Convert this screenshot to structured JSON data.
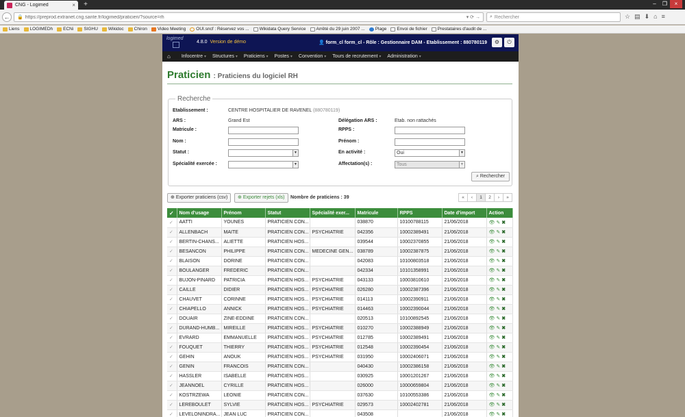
{
  "browser": {
    "tab_title": "CNG - Logimed",
    "url": "https://preprod.extranet.cng.sante.fr/logimed/praticien/?source=rh",
    "search_placeholder": "Rechercher",
    "bookmarks": [
      "Liens",
      "LOGIMEDh",
      "ECNi",
      "SIGHU",
      "Wikidoc",
      "Chiron",
      "Video Meeting",
      "OUI.sncf : Réservez vos ...",
      "Wikidata Query Service",
      "Arrêté du 29 juin 2007 ...",
      "Plage",
      "Envoi de fichier",
      "Prestataires d'audit de ..."
    ]
  },
  "header": {
    "logo": "logimed",
    "version": "4.8.0",
    "version_note": "Version de démo",
    "user": "form_cl form_cl - Rôle : Gestionnaire DAM - Etablissement : 880780119"
  },
  "nav": [
    "Infocentre",
    "Structures",
    "Praticiens",
    "Postes",
    "Convention",
    "Tours de recrutement",
    "Administration"
  ],
  "page": {
    "title": "Praticien",
    "subtitle": ": Praticiens du logiciel RH"
  },
  "search": {
    "legend": "Recherche",
    "etablissement_label": "Etablissement :",
    "etablissement_value": "CENTRE HOSPITALIER DE RAVENEL",
    "etablissement_code": "(880780119)",
    "ars_label": "ARS :",
    "ars_value": "Grand Est",
    "delegation_label": "Délégation ARS :",
    "delegation_value": "Etab. non rattachés",
    "matricule_label": "Matricule :",
    "rpps_label": "RPPS :",
    "nom_label": "Nom :",
    "prenom_label": "Prénom :",
    "statut_label": "Statut :",
    "activite_label": "En activité :",
    "activite_value": "Oui",
    "specialite_label": "Spécialité exercée :",
    "affectation_label": "Affectation(s) :",
    "affectation_value": "Tous",
    "button": "Rechercher"
  },
  "toolbar": {
    "export_praticiens": "Exporter praticiens (csv)",
    "export_rejets": "Exporter rejets (xls)",
    "count": "Nombre de praticiens : 39"
  },
  "pager": [
    "«",
    "‹",
    "1",
    "2",
    "›",
    "»"
  ],
  "table": {
    "columns": [
      "Nom d'usage",
      "Prénom",
      "Statut",
      "Spécialité exer...",
      "Matricule",
      "RPPS",
      "Date d'import",
      "Action"
    ],
    "rows": [
      [
        "AATTI",
        "YOUNES",
        "PRATICIEN CON...",
        "",
        "038870",
        "10100788115",
        "21/06/2018"
      ],
      [
        "ALLENBACH",
        "MAITE",
        "PRATICIEN CON...",
        "PSYCHIATRIE",
        "042356",
        "10002389491",
        "21/06/2018"
      ],
      [
        "BERTIN-CHANS...",
        "ALIETTE",
        "PRATICIEN HOS...",
        "",
        "039544",
        "10002370855",
        "21/06/2018"
      ],
      [
        "BESANCON",
        "PHILIPPE",
        "PRATICIEN CON...",
        "MEDECINE GEN...",
        "038789",
        "10002387875",
        "21/06/2018"
      ],
      [
        "BLAISON",
        "DORINE",
        "PRATICIEN CON...",
        "",
        "042083",
        "10100803518",
        "21/06/2018"
      ],
      [
        "BOULANGER",
        "FREDERIC",
        "PRATICIEN CON...",
        "",
        "042334",
        "10101358991",
        "21/06/2018"
      ],
      [
        "BUJON-PINARD",
        "PATRICIA",
        "PRATICIEN HOS...",
        "PSYCHIATRIE",
        "043133",
        "10003810610",
        "21/06/2018"
      ],
      [
        "CAILLE",
        "DIDIER",
        "PRATICIEN HOS...",
        "PSYCHIATRIE",
        "026280",
        "10002387396",
        "21/06/2018"
      ],
      [
        "CHAUVET",
        "CORINNE",
        "PRATICIEN HOS...",
        "PSYCHIATRIE",
        "014113",
        "10002390911",
        "21/06/2018"
      ],
      [
        "CHIAPELLO",
        "ANNICK",
        "PRATICIEN HOS...",
        "PSYCHIATRIE",
        "014463",
        "10002390044",
        "21/06/2018"
      ],
      [
        "DOUAIR",
        "ZINE-EDDINE",
        "PRATICIEN CON...",
        "",
        "020513",
        "10100892545",
        "21/06/2018"
      ],
      [
        "DURAND-HUMB...",
        "MIREILLE",
        "PRATICIEN HOS...",
        "PSYCHIATRIE",
        "010270",
        "10002388949",
        "21/06/2018"
      ],
      [
        "EVRARD",
        "EMMANUELLE",
        "PRATICIEN HOS...",
        "PSYCHIATRIE",
        "012785",
        "10002389491",
        "21/06/2018"
      ],
      [
        "FOUQUET",
        "THIERRY",
        "PRATICIEN HOS...",
        "PSYCHIATRIE",
        "012548",
        "10002390454",
        "21/06/2018"
      ],
      [
        "GEHIN",
        "ANOUK",
        "PRATICIEN HOS...",
        "PSYCHIATRIE",
        "031950",
        "10002406071",
        "21/06/2018"
      ],
      [
        "GENIN",
        "FRANCOIS",
        "PRATICIEN CON...",
        "",
        "040430",
        "10002386158",
        "21/06/2018"
      ],
      [
        "HASSLER",
        "ISABELLE",
        "PRATICIEN HOS...",
        "",
        "030925",
        "10001201267",
        "21/06/2018"
      ],
      [
        "JEANNOEL",
        "CYRILLE",
        "PRATICIEN HOS...",
        "",
        "026000",
        "10000659804",
        "21/06/2018"
      ],
      [
        "KOSTRZEWA",
        "LEONIE",
        "PRATICIEN CON...",
        "",
        "037630",
        "10100553386",
        "21/06/2018"
      ],
      [
        "LEREBOULET",
        "SYLVIE",
        "PRATICIEN HOS...",
        "PSYCHIATRIE",
        "029573",
        "10002402781",
        "21/06/2018"
      ],
      [
        "LEVELONINDRA...",
        "JEAN LUC",
        "PRATICIEN CON...",
        "",
        "043508",
        "",
        "21/06/2018"
      ]
    ]
  },
  "colors": {
    "header_bg": "#0e1554",
    "table_header": "#3c8d3c",
    "title_green": "#2d7a2d"
  }
}
